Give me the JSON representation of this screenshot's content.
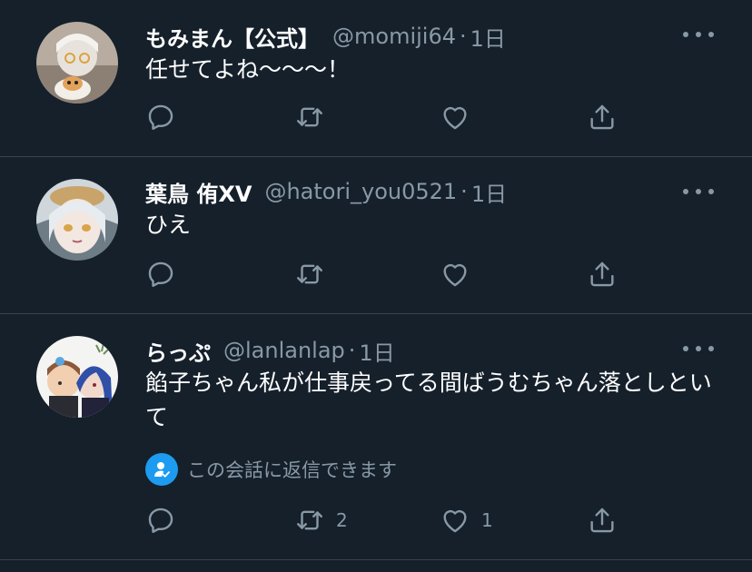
{
  "tweets": [
    {
      "name": "もみまん【公式】",
      "handle": "@momiji64",
      "separator": "·",
      "time": "1日",
      "text": "任せてよね〜〜〜！",
      "reply_count": "",
      "retweet_count": "",
      "like_count": ""
    },
    {
      "name": "葉鳥 侑XV",
      "handle": "@hatori_you0521",
      "separator": "·",
      "time": "1日",
      "text": "ひえ",
      "reply_count": "",
      "retweet_count": "",
      "like_count": ""
    },
    {
      "name": "らっぷ",
      "handle": "@lanlanlap",
      "separator": "·",
      "time": "1日",
      "text": "餡子ちゃん私が仕事戻ってる間ばうむちゃん落としといて",
      "reply_restriction": "この会話に返信できます",
      "reply_count": "",
      "retweet_count": "2",
      "like_count": "1"
    }
  ],
  "icons": {
    "reply": "reply-icon",
    "retweet": "retweet-icon",
    "like": "like-icon",
    "share": "share-icon",
    "more": "more-icon",
    "restrict": "user-check-icon"
  },
  "colors": {
    "background": "#15202b",
    "secondary_text": "#8899a6",
    "divider": "#38444d",
    "accent": "#1d9bf0"
  }
}
